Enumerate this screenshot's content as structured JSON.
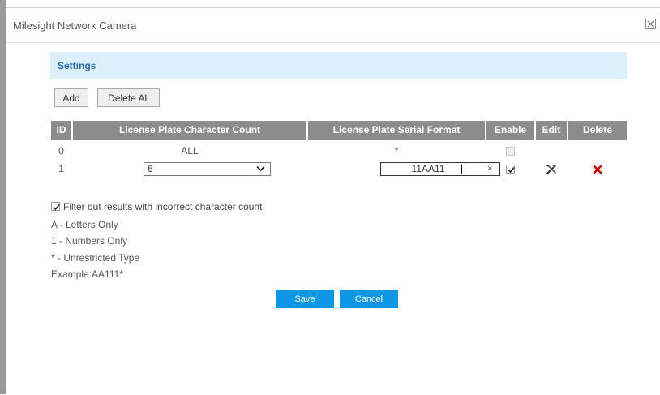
{
  "window": {
    "title": "Milesight Network Camera",
    "close_icon": "close-icon"
  },
  "section": {
    "title": "Settings"
  },
  "toolbar": {
    "add_label": "Add",
    "delete_all_label": "Delete All"
  },
  "table": {
    "headers": {
      "id": "ID",
      "count": "License Plate Character Count",
      "format": "License Plate Serial Format",
      "enable": "Enable",
      "edit": "Edit",
      "delete": "Delete"
    },
    "rows": [
      {
        "id": "0",
        "count": "ALL",
        "format": "*",
        "enabled": false,
        "enable_disabled": true
      },
      {
        "id": "1",
        "count": "6",
        "format": "11AA11",
        "enabled": true,
        "edit_icon": "tools-icon",
        "delete_icon": "red-x-icon"
      }
    ]
  },
  "filter": {
    "checked": true,
    "label": "Filter out results with incorrect character count"
  },
  "legend": {
    "letters": "A - Letters Only",
    "numbers": "1 - Numbers Only",
    "unrestricted": "* - Unrestricted Type",
    "example": "Example:AA111*"
  },
  "actions": {
    "save_label": "Save",
    "cancel_label": "Cancel"
  },
  "colors": {
    "header_bg": "#8c8c8c",
    "settings_bg": "#dbf0fb",
    "settings_text": "#2b6aa5",
    "primary_button": "#0d97e5",
    "delete_icon": "#cc0000"
  }
}
